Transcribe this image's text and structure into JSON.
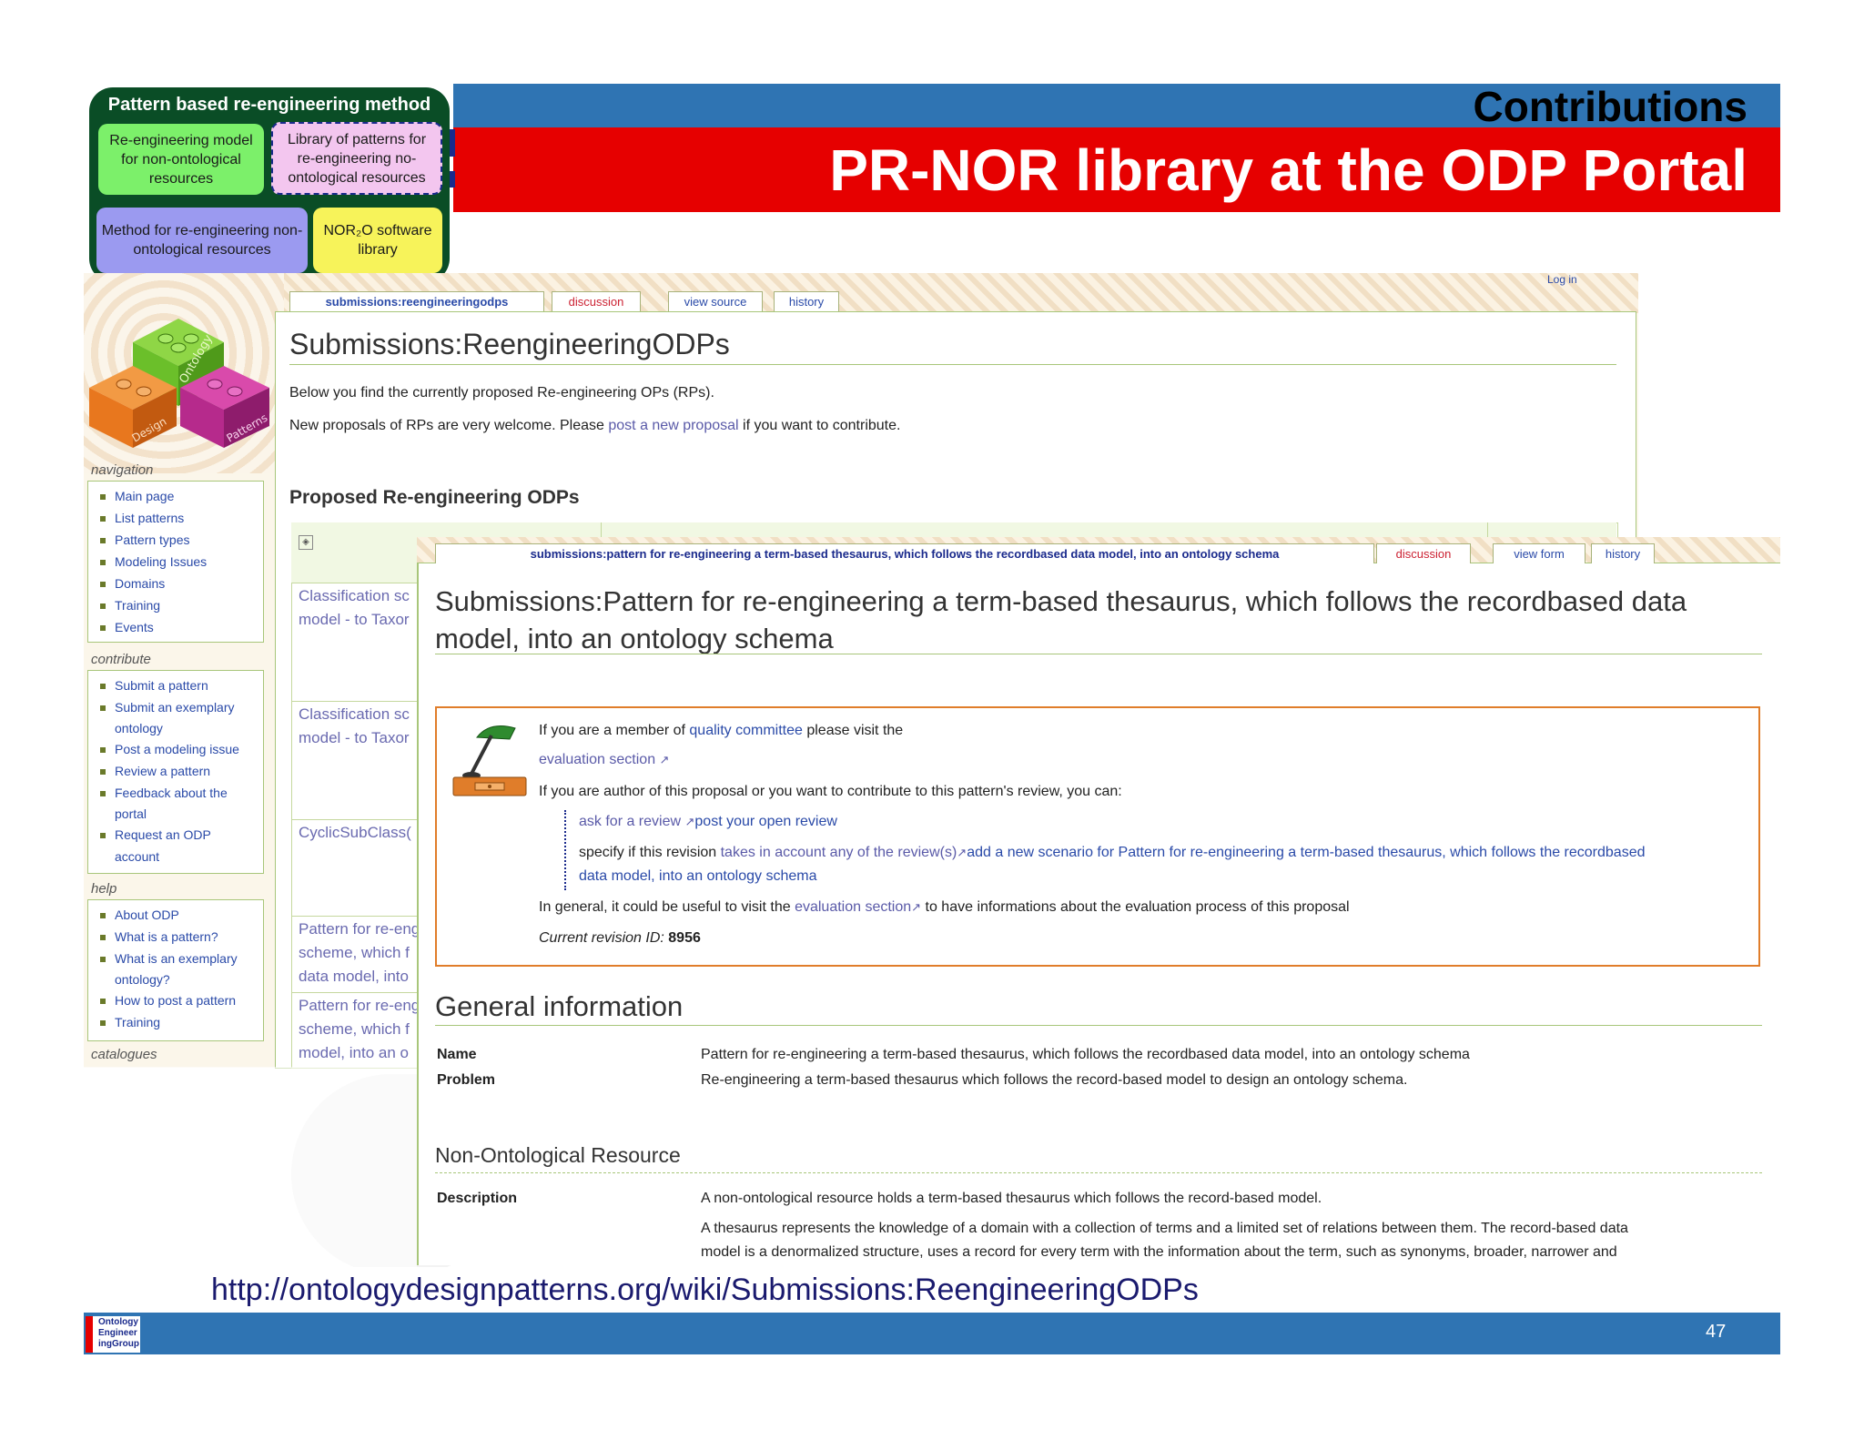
{
  "header": {
    "section": "Contributions",
    "title": "PR-NOR library at the ODP Portal"
  },
  "method": {
    "title": "Pattern based re-engineering method",
    "box1": "Re-engineering model for non-ontological resources",
    "box2": "Library of patterns for re-engineering no-ontological resources",
    "box3": "Method for re-engineering non-ontological resources",
    "box4": "NOR₂O software library"
  },
  "logo": {
    "words": [
      "Ontology",
      "Design",
      "Patterns"
    ],
    "colors": {
      "green": "#6bbf2a",
      "orange": "#e8771e",
      "magenta": "#b62a8c"
    }
  },
  "wiki_back": {
    "tabs": [
      "submissions:reengineeringodps",
      "discussion",
      "view source",
      "history"
    ],
    "login": "Log in",
    "heading": "Submissions:ReengineeringODPs",
    "intro": "Below you find the currently proposed Re-engineering OPs (RPs).",
    "p2_before": "New proposals of RPs are very welcome. Please ",
    "p2_link": "post a new proposal",
    "p2_after": " if you want to contribute.",
    "subheading": "Proposed Re-engineering ODPs",
    "rows": [
      [
        "Classification sc",
        "model - to Taxor"
      ],
      [
        "Classification sc",
        "model - to Taxor"
      ],
      [
        "CyclicSubClass("
      ],
      [
        "Pattern for re-eng",
        "scheme, which f",
        "data model, into"
      ],
      [
        "Pattern for re-eng",
        "scheme, which f",
        "model, into an o"
      ]
    ]
  },
  "sidebar": {
    "navigation": {
      "title": "navigation",
      "items": [
        "Main page",
        "List patterns",
        "Pattern types",
        "Modeling Issues",
        "Domains",
        "Training",
        "Events"
      ]
    },
    "contribute": {
      "title": "contribute",
      "items": [
        "Submit a pattern",
        "Submit an exemplary",
        "ontology",
        "Post a modeling issue",
        "Review a pattern",
        "Feedback about the",
        "portal",
        "Request an ODP",
        "account"
      ]
    },
    "help": {
      "title": "help",
      "items": [
        "About ODP",
        "What is a pattern?",
        "What is an exemplary",
        "ontology?",
        "How to post a pattern",
        "Training"
      ]
    },
    "catalogues": {
      "title": "catalogues"
    }
  },
  "wiki_front": {
    "tabs": [
      "submissions:pattern for re-engineering a term-based thesaurus, which follows the recordbased data model, into an ontology schema",
      "discussion",
      "view form",
      "history"
    ],
    "heading": "Submissions:Pattern for re-engineering a term-based thesaurus, which follows the recordbased data model, into an ontology schema",
    "notice": {
      "l1_before": "If you are a member of ",
      "l1_link": "quality committee",
      "l1_after": " please visit the",
      "l2_link": "evaluation section",
      "l3": "If you are author of this proposal or you want to contribute to this pattern's review, you can:",
      "l4_link1": "ask for a review",
      "l4_link2": "post your open review",
      "l5_before": "specify if this revision ",
      "l5_link1": "takes in account any of the review(s)",
      "l5_link2": "add a new scenario for Pattern for re-engineering a term-based thesaurus, which follows the recordbased",
      "l6_link": "data model, into an ontology schema",
      "l7_before": "In general, it could be useful to visit the ",
      "l7_link": "evaluation section",
      "l7_after": " to have informations about the evaluation process of this proposal",
      "l8_label": "Current revision ID:",
      "l8_value": "8956"
    },
    "general": {
      "title": "General information",
      "name_label": "Name",
      "name_value": "Pattern for re-engineering a term-based thesaurus, which follows the recordbased data model, into an ontology schema",
      "problem_label": "Problem",
      "problem_value": "Re-engineering a term-based thesaurus which follows the record-based model to design an ontology schema."
    },
    "nor": {
      "title": "Non-Ontological Resource",
      "desc_label": "Description",
      "desc_p1": "A non-ontological resource holds a term-based thesaurus which follows the record-based model.",
      "desc_p2a": "A thesaurus represents the knowledge of a domain with a collection of terms and a limited set of relations between them. The record-based data",
      "desc_p2b": "model is a denormalized structure, uses a record for every term with the information about the term, such as synonyms, broader, narrower and"
    }
  },
  "footer": {
    "url": "http://ontologydesignpatterns.org/wiki/Submissions:ReengineeringODPs",
    "page": "47",
    "logo_lines": [
      "Ontology",
      "Engineer",
      "ingGroup"
    ]
  }
}
